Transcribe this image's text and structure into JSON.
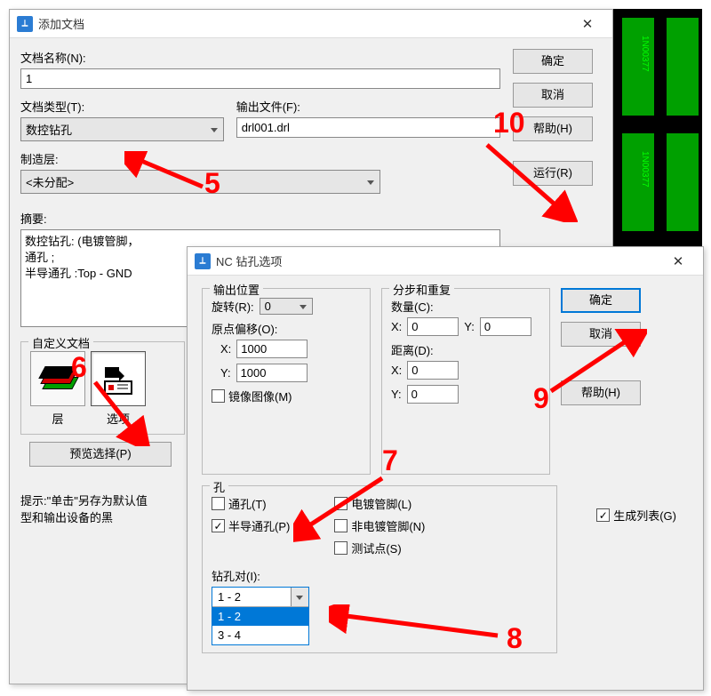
{
  "bg": {
    "label": "1N00377"
  },
  "dialog1": {
    "title": "添加文档",
    "close": "✕",
    "doc_name_label": "文档名称(N):",
    "doc_name_value": "1",
    "doc_type_label": "文档类型(T):",
    "doc_type_value": "数控钻孔",
    "output_file_label": "输出文件(F):",
    "output_file_value": "drl001.drl",
    "fab_layer_label": "制造层:",
    "fab_layer_value": "<未分配>",
    "summary_label": "摘要:",
    "summary_text": "数控钻孔: (电镀管脚，\n通孔 ;\n半导通孔 :Top - GND",
    "custom_doc_label": "自定义文档",
    "layer_btn_label": "层",
    "options_btn_label": "选项",
    "preview_btn": "预览选择(P)",
    "ok_btn": "确定",
    "cancel_btn": "取消",
    "help_btn": "帮助(H)",
    "run_btn": "运行(R)",
    "tip": "提示:\"单击\"另存为默认值\n    型和输出设备的黑"
  },
  "dialog2": {
    "title": "NC 钻孔选项",
    "close": "✕",
    "grp_output": "输出位置",
    "rotate_label": "旋转(R):",
    "rotate_value": "0",
    "origin_label": "原点偏移(O):",
    "x_label": "X:",
    "y_label": "Y:",
    "ox_value": "1000",
    "oy_value": "1000",
    "mirror_label": "镜像图像(M)",
    "grp_step": "分步和重复",
    "count_label": "数量(C):",
    "cx_value": "0",
    "cy_value": "0",
    "dist_label": "距离(D):",
    "dx_value": "0",
    "dy_value": "0",
    "grp_holes": "孔",
    "through_label": "通孔(T)",
    "partial_label": "半导通孔(P)",
    "plated_label": "电镀管脚(L)",
    "nonplated_label": "非电镀管脚(N)",
    "test_label": "测试点(S)",
    "pair_label": "钻孔对(I):",
    "pair_value": "1 - 2",
    "pair_opt1": "1 - 2",
    "pair_opt2": "3 - 4",
    "genlist_label": "生成列表(G)",
    "ok_btn": "确定",
    "cancel_btn": "取消",
    "help_btn": "帮助(H)"
  },
  "annotations": {
    "n5": "5",
    "n6": "6",
    "n7": "7",
    "n8": "8",
    "n9": "9",
    "n10": "10"
  }
}
